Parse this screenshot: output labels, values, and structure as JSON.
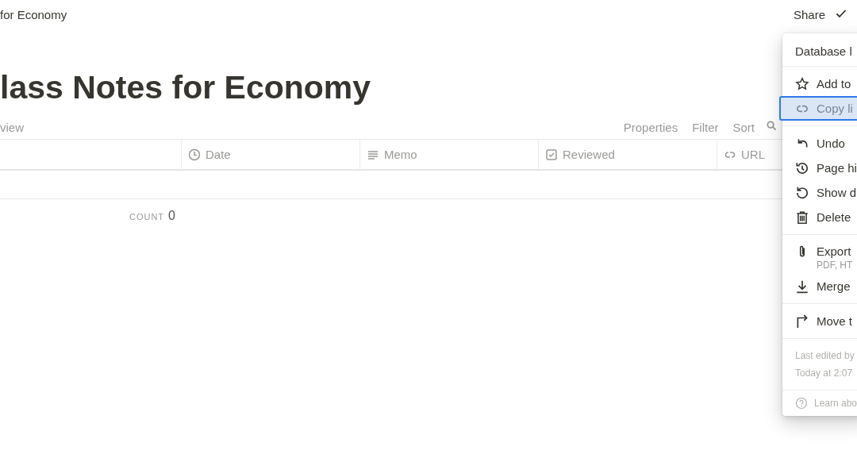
{
  "topbar": {
    "breadcrumb": "for Economy",
    "share": "Share"
  },
  "title": "lass Notes for Economy",
  "view_tab": "view",
  "toolbar": [
    "Properties",
    "Filter",
    "Sort"
  ],
  "table": {
    "columns": [
      {
        "label": "Date",
        "kind": "date"
      },
      {
        "label": "Memo",
        "kind": "text"
      },
      {
        "label": "Reviewed",
        "kind": "checkbox"
      },
      {
        "label": "URL",
        "kind": "url"
      }
    ],
    "count_label": "COUNT",
    "count": "0"
  },
  "menu": {
    "header": "Database l",
    "sections": [
      [
        {
          "label": "Add to",
          "kind": "star",
          "selected": false
        },
        {
          "label": "Copy li",
          "kind": "link",
          "selected": true
        }
      ],
      [
        {
          "label": "Undo",
          "kind": "undo",
          "selected": false
        },
        {
          "label": "Page hi",
          "kind": "history",
          "selected": false
        },
        {
          "label": "Show d",
          "kind": "restore",
          "selected": false
        },
        {
          "label": "Delete",
          "kind": "trash",
          "selected": false
        }
      ],
      [
        {
          "label": "Export",
          "sub": "PDF, HT",
          "kind": "clip",
          "selected": false
        },
        {
          "label": "Merge",
          "kind": "download",
          "selected": false
        }
      ],
      [
        {
          "label": "Move t",
          "kind": "move",
          "selected": false
        }
      ]
    ],
    "info": [
      "Last edited by",
      "Today at 2:07"
    ],
    "help": "Learn abo"
  }
}
